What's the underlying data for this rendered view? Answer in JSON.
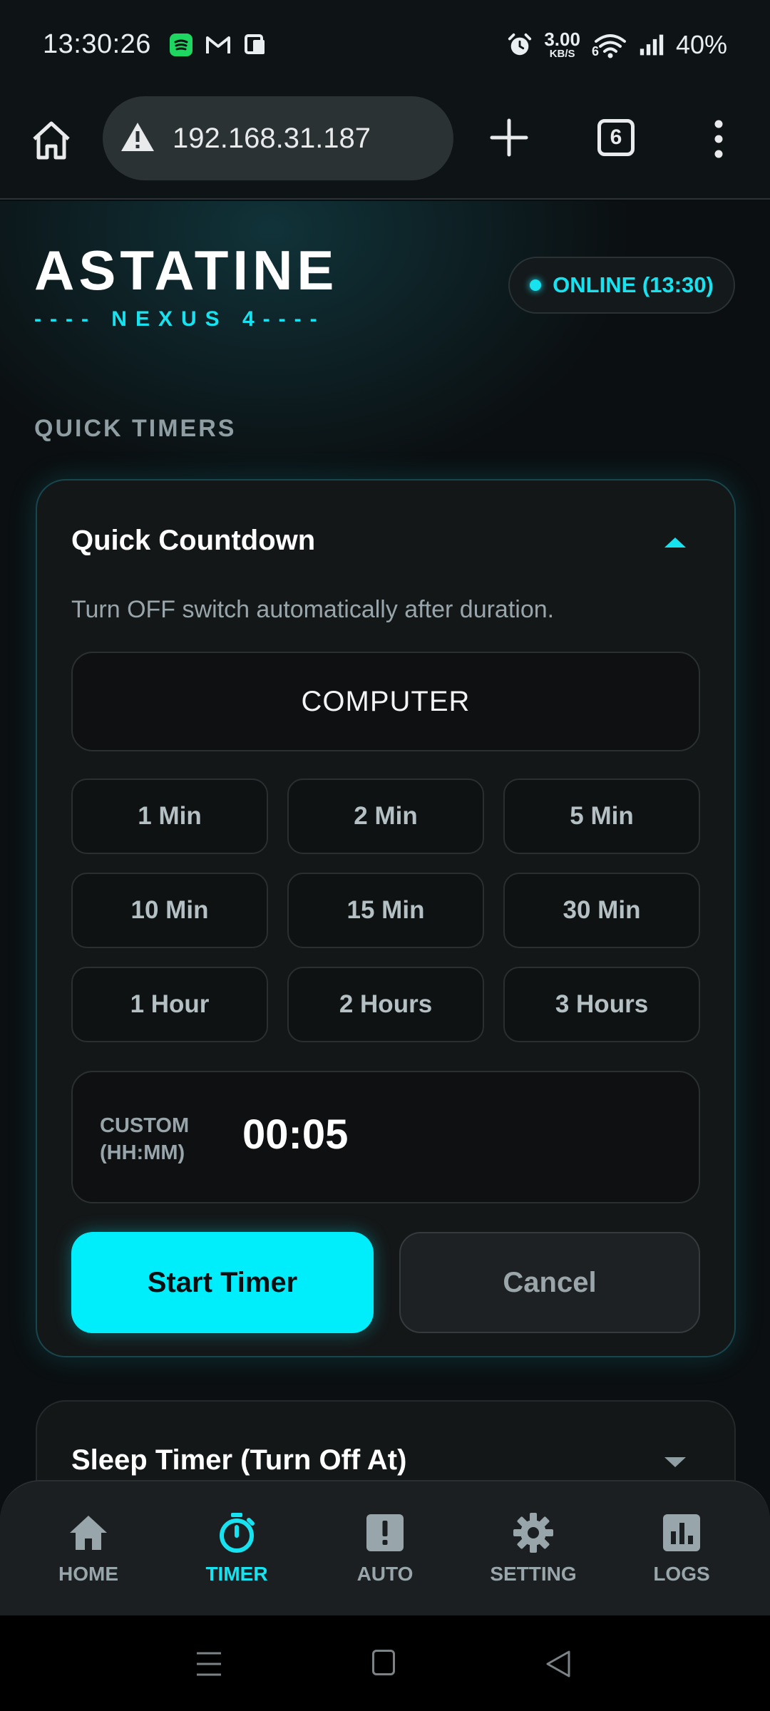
{
  "status_bar": {
    "time": "13:30:26",
    "net_speed_value": "3.00",
    "net_speed_unit": "KB/S",
    "wifi_label": "6",
    "battery": "40%"
  },
  "browser": {
    "url": "192.168.31.187",
    "tab_count": "6"
  },
  "brand": {
    "title": "ASTATINE",
    "subtitle": "---- NEXUS 4----"
  },
  "status": {
    "label": "ONLINE (13:30)",
    "color": "#17e3f0"
  },
  "section": {
    "label": "QUICK TIMERS"
  },
  "quick_countdown": {
    "title": "Quick Countdown",
    "description": "Turn OFF switch automatically after duration.",
    "device": "COMPUTER",
    "presets": [
      "1 Min",
      "2 Min",
      "5 Min",
      "10 Min",
      "15 Min",
      "30 Min",
      "1 Hour",
      "2 Hours",
      "3 Hours"
    ],
    "custom_label_line1": "CUSTOM",
    "custom_label_line2": "(HH:MM)",
    "custom_value": "00:05",
    "start_label": "Start Timer",
    "cancel_label": "Cancel"
  },
  "sleep_timer": {
    "title": "Sleep Timer (Turn Off At)"
  },
  "bottom_nav": {
    "items": [
      {
        "label": "HOME",
        "icon": "home-icon"
      },
      {
        "label": "TIMER",
        "icon": "stopwatch-icon",
        "active": true
      },
      {
        "label": "AUTO",
        "icon": "alert-icon"
      },
      {
        "label": "SETTING",
        "icon": "gear-icon"
      },
      {
        "label": "LOGS",
        "icon": "bar-chart-icon"
      }
    ]
  },
  "colors": {
    "accent": "#17e3f0",
    "start_button": "#00eefc",
    "background": "#0b0f11",
    "card": "#141718"
  }
}
